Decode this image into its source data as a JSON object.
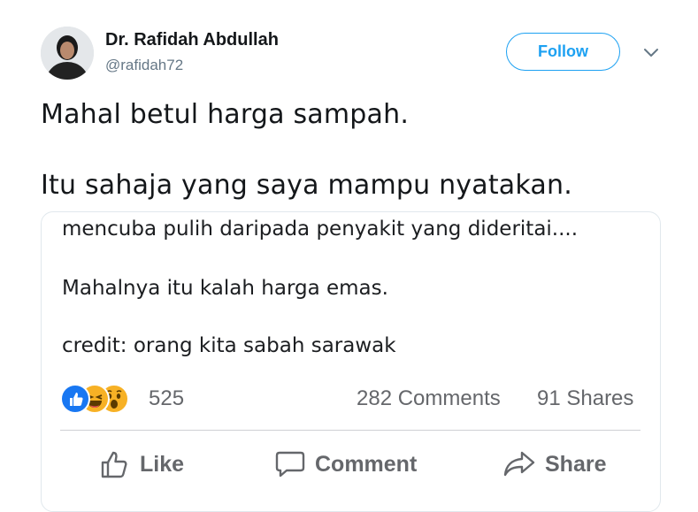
{
  "tweet": {
    "author_name": "Dr. Rafidah Abdullah",
    "author_handle": "@rafidah72",
    "follow_label": "Follow",
    "line1": "Mahal betul harga sampah.",
    "line2": "Itu sahaja yang saya mampu nyatakan."
  },
  "card": {
    "line1": "mencuba pulih daripada penyakit yang dideritai....",
    "line2": "Mahalnya itu kalah harga emas.",
    "line3": "credit: orang kita sabah sarawak",
    "reaction_count": "525",
    "comments": "282 Comments",
    "shares": "91 Shares",
    "actions": {
      "like": "Like",
      "comment": "Comment",
      "share": "Share"
    }
  },
  "colors": {
    "twitter_blue": "#1da1f2",
    "fb_gray": "#65676b",
    "like_blue": "#1877f2",
    "emoji_yellow": "#f7b125"
  },
  "icons": [
    "caret-down-icon",
    "like-reaction-icon",
    "haha-reaction-icon",
    "wow-reaction-icon",
    "thumbs-up-icon",
    "comment-bubble-icon",
    "share-arrow-icon"
  ]
}
